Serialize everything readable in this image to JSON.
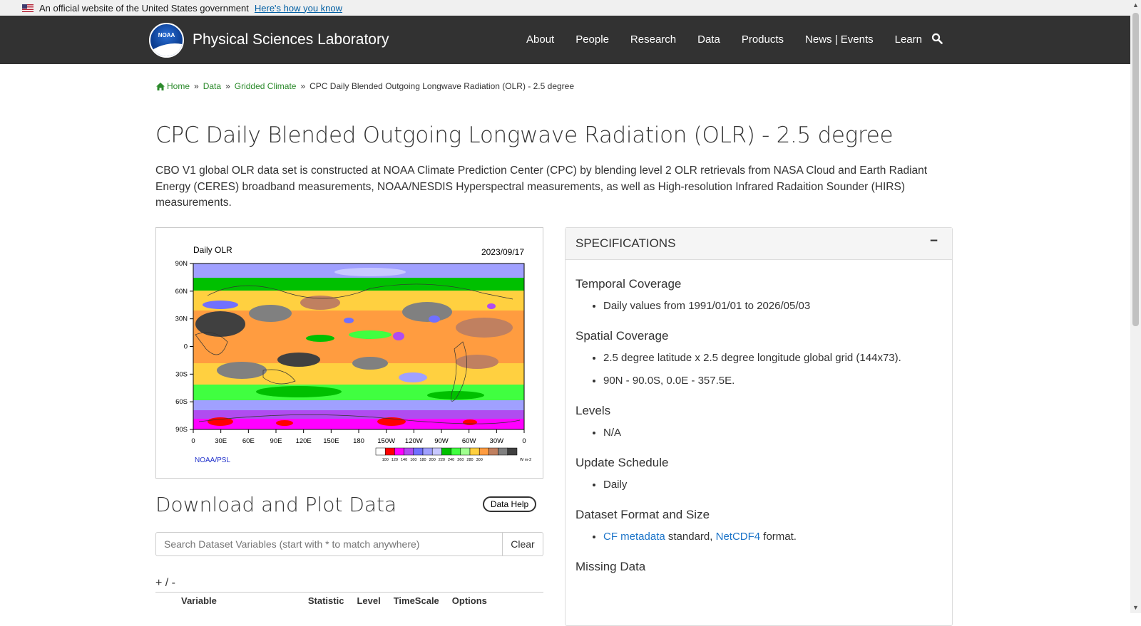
{
  "gov_banner": {
    "text": "An official website of the United States government",
    "link": "Here's how you know"
  },
  "header": {
    "logo_text": "NOAA",
    "site_title": "Physical Sciences Laboratory",
    "nav": [
      "About",
      "People",
      "Research",
      "Data",
      "Products",
      "News | Events",
      "Learn"
    ]
  },
  "breadcrumb": {
    "home": "Home",
    "data": "Data",
    "gridded": "Gridded Climate",
    "sep": "»",
    "current": "CPC Daily Blended Outgoing Longwave Radiation (OLR) - 2.5 degree"
  },
  "page_title": "CPC Daily Blended Outgoing Longwave Radiation (OLR) - 2.5 degree",
  "description": "CBO V1 global OLR data set is constructed at NOAA Climate Prediction Center (CPC) by blending level 2 OLR retrievals from NASA Cloud and Earth Radiant Energy (CERES) broadband measurements, NOAA/NESDIS Hyperspectral measurements, as well as High-resolution Infrared Radaition Sounder (HIRS) measurements.",
  "plot": {
    "title": "Daily OLR",
    "date": "2023/09/17",
    "credit": "NOAA/PSL",
    "lat_labels": [
      "90N",
      "60N",
      "30N",
      "0",
      "30S",
      "60S",
      "90S"
    ],
    "lon_labels": [
      "0",
      "30E",
      "60E",
      "90E",
      "120E",
      "150E",
      "180",
      "150W",
      "120W",
      "90W",
      "60W",
      "30W",
      "0"
    ],
    "colorbar_labels": [
      "100",
      "120",
      "140",
      "160",
      "180",
      "200",
      "220",
      "240",
      "260",
      "280",
      "300"
    ],
    "colorbar_unit": "W m-2",
    "colorbar_colors": [
      "#ffffff",
      "#ff0000",
      "#ff00ff",
      "#b04cf0",
      "#7070ff",
      "#a0a0ff",
      "#c8c8ff",
      "#00c000",
      "#40ff40",
      "#a0ff90",
      "#ffd040",
      "#ff9c40",
      "#c08060",
      "#808080",
      "#404040"
    ]
  },
  "download": {
    "title": "Download and Plot Data",
    "help": "Data Help",
    "search_placeholder": "Search Dataset Variables (start with * to match anywhere)",
    "clear": "Clear",
    "plusminus": "+ / -",
    "columns": [
      "Variable",
      "Statistic",
      "Level",
      "TimeScale",
      "Options"
    ]
  },
  "specifications": {
    "title": "SPECIFICATIONS",
    "collapse": "−",
    "temporal_h": "Temporal Coverage",
    "temporal": "Daily values from 1991/01/01 to 2026/05/03",
    "spatial_h": "Spatial Coverage",
    "spatial_1": "2.5 degree latitude x 2.5 degree longitude global grid (144x73).",
    "spatial_2": "90N - 90.0S, 0.0E - 357.5E.",
    "levels_h": "Levels",
    "levels": "N/A",
    "update_h": "Update Schedule",
    "update": "Daily",
    "format_h": "Dataset Format and Size",
    "format_link1": "CF metadata",
    "format_mid": " standard, ",
    "format_link2": "NetCDF4",
    "format_end": " format.",
    "missing_h": "Missing Data"
  }
}
